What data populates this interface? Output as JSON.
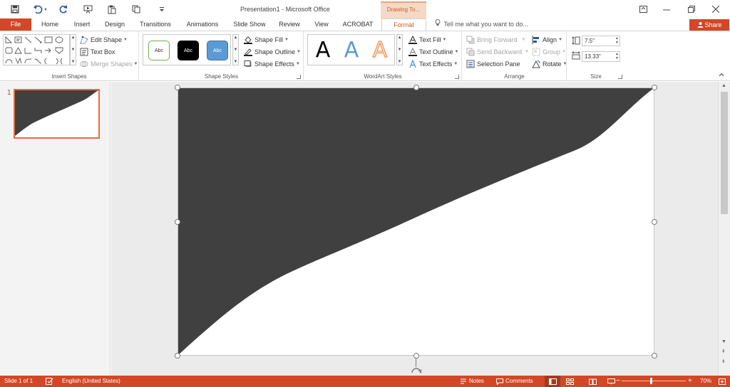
{
  "app": {
    "doc_title": "Presentation1 - Microsoft Office",
    "context_tab_title": "Drawing To..."
  },
  "ribbon_tabs": {
    "file": "File",
    "tabs": [
      "Home",
      "Insert",
      "Design",
      "Transitions",
      "Animations",
      "Slide Show",
      "Review",
      "View",
      "ACROBAT",
      "Format"
    ],
    "active": "Format",
    "tell_me": "Tell me what you want to do...",
    "share": "Share"
  },
  "ribbon": {
    "insert_shapes": {
      "label": "Insert Shapes",
      "edit_shape": "Edit Shape",
      "text_box": "Text Box",
      "merge_shapes": "Merge Shapes"
    },
    "shape_styles": {
      "label": "Shape Styles",
      "swatches": [
        "Abc",
        "Abc",
        "Abc"
      ],
      "shape_fill": "Shape Fill",
      "shape_outline": "Shape Outline",
      "shape_effects": "Shape Effects"
    },
    "wordart_styles": {
      "label": "WordArt Styles",
      "letters": [
        "A",
        "A",
        "A"
      ],
      "text_fill": "Text Fill",
      "text_outline": "Text Outline",
      "text_effects": "Text Effects"
    },
    "arrange": {
      "label": "Arrange",
      "bring_forward": "Bring Forward",
      "send_backward": "Send Backward",
      "selection_pane": "Selection Pane",
      "align": "Align",
      "group": "Group",
      "rotate": "Rotate"
    },
    "size": {
      "label": "Size",
      "height": "7.5\"",
      "width": "13.33\""
    }
  },
  "slides_pane": {
    "slide_number": "1"
  },
  "statusbar": {
    "slide_info": "Slide 1 of 1",
    "language": "English (United States)",
    "notes": "Notes",
    "comments": "Comments",
    "zoom": "70%",
    "zoom_level": 0.46
  },
  "colors": {
    "accent": "#d24726",
    "shape_fill": "#404040"
  }
}
